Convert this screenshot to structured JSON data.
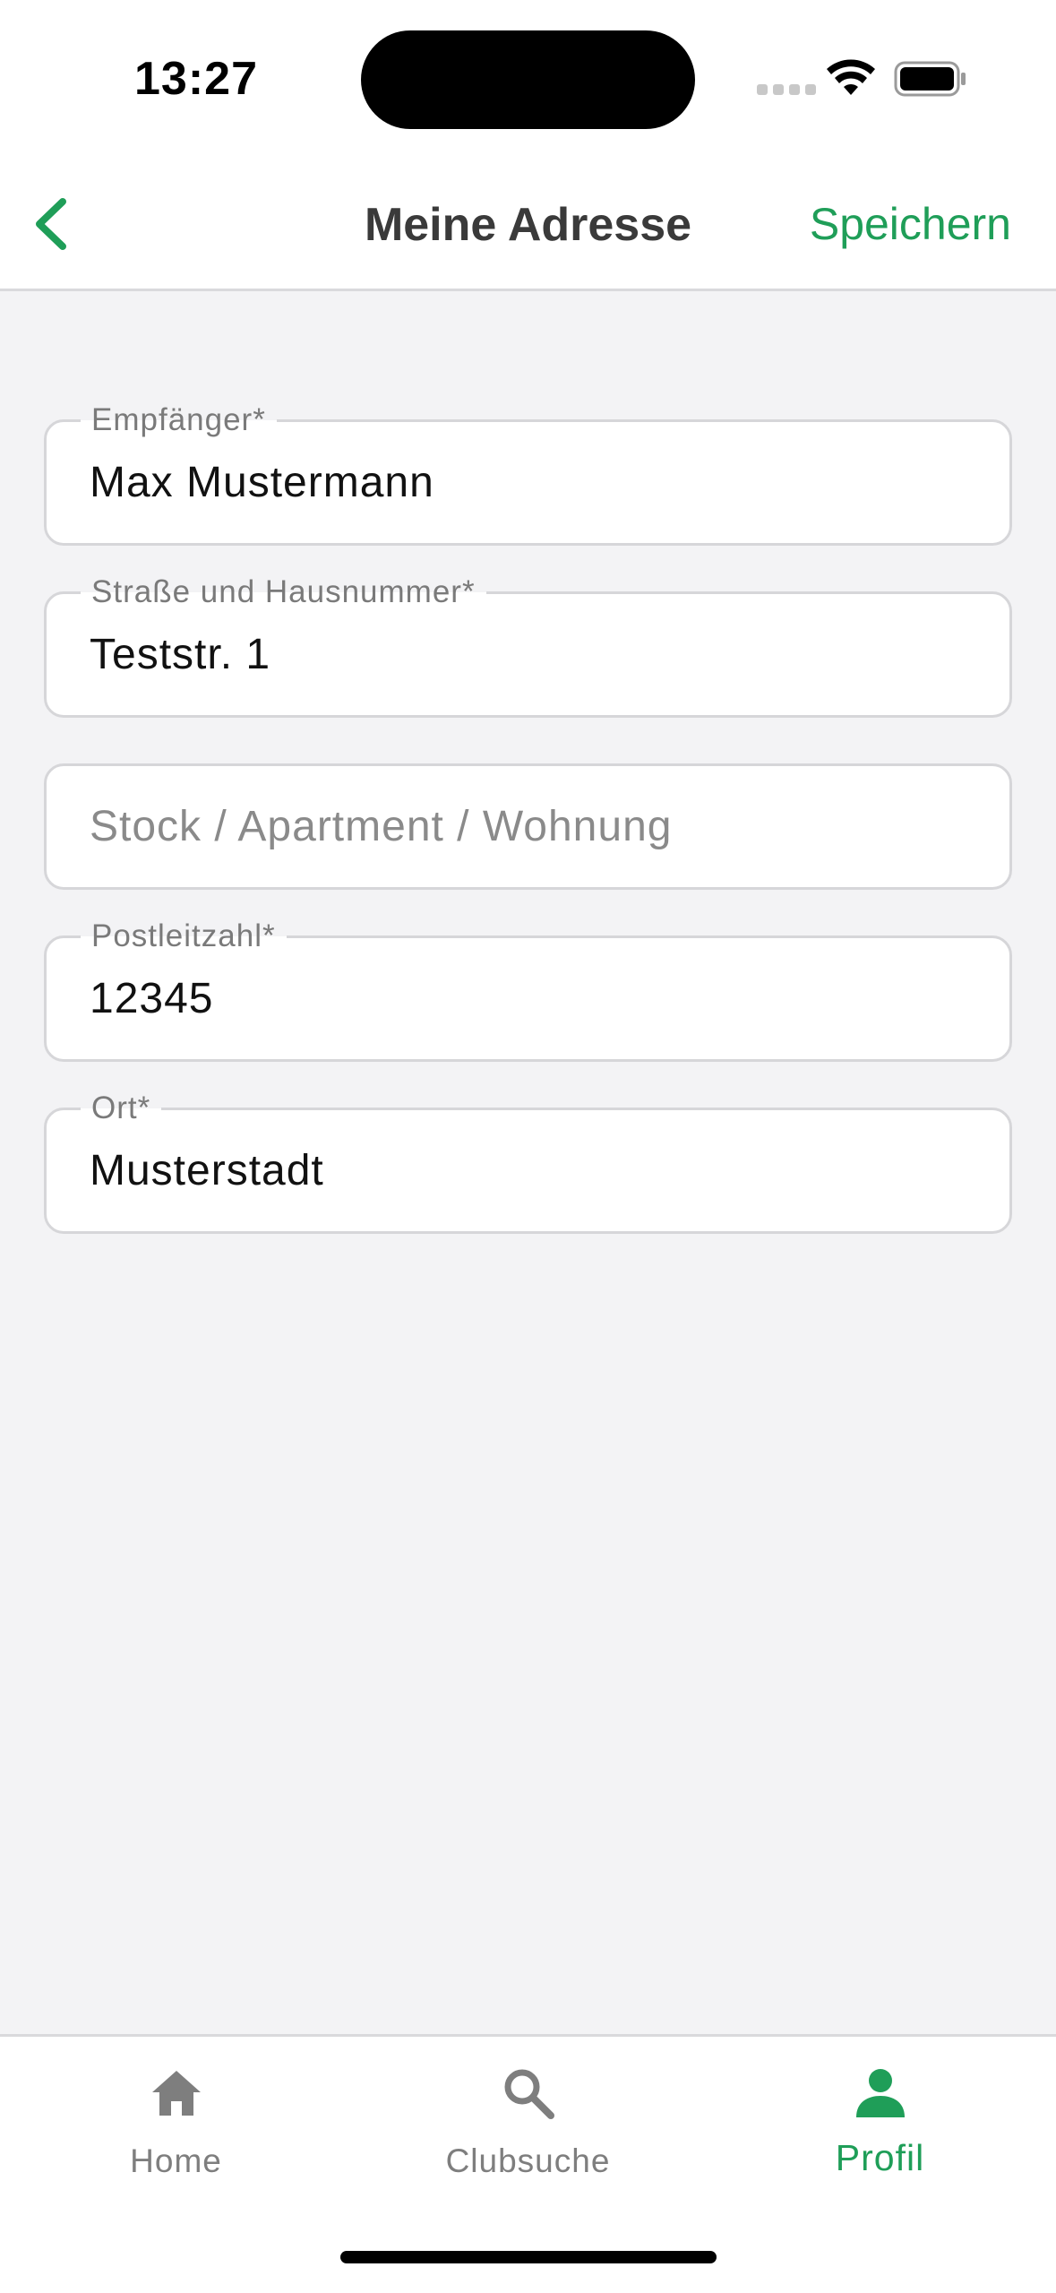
{
  "status_bar": {
    "time": "13:27"
  },
  "header": {
    "title": "Meine Adresse",
    "save_label": "Speichern"
  },
  "form": {
    "fields": [
      {
        "label": "Empfänger*",
        "value": "Max Mustermann"
      },
      {
        "label": "Straße und Hausnummer*",
        "value": "Teststr. 1"
      },
      {
        "label": "",
        "value": "",
        "placeholder": "Stock / Apartment / Wohnung"
      },
      {
        "label": "Postleitzahl*",
        "value": "12345"
      },
      {
        "label": "Ort*",
        "value": "Musterstadt"
      }
    ]
  },
  "tab_bar": {
    "items": [
      {
        "label": "Home",
        "icon": "home-icon",
        "active": false
      },
      {
        "label": "Clubsuche",
        "icon": "search-icon",
        "active": false
      },
      {
        "label": "Profil",
        "icon": "person-icon",
        "active": true
      }
    ]
  },
  "colors": {
    "accent": "#1f9e58",
    "background": "#f3f3f5",
    "inactive": "#7e7e7e"
  }
}
